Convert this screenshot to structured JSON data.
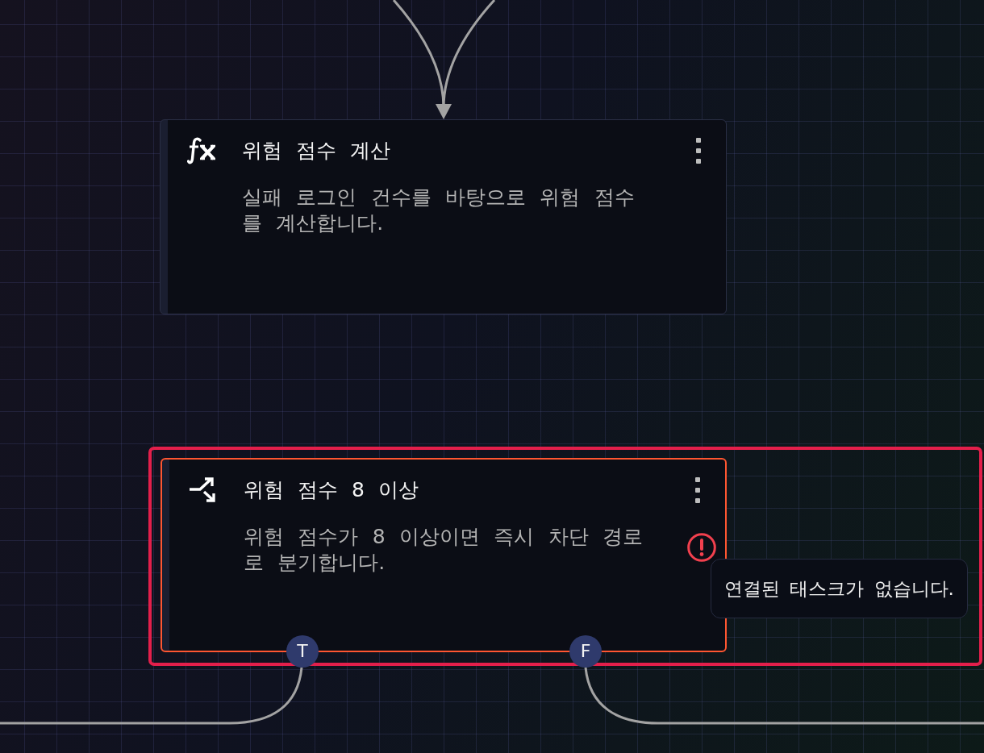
{
  "canvas": {
    "nodes": [
      {
        "kind": "function",
        "title": "위험 점수 계산",
        "description": "실패 로그인 건수를 바탕으로 위험 점수를 계산합니다.",
        "selected": false,
        "invalid": false
      },
      {
        "kind": "condition",
        "title": "위험 점수 8 이상",
        "description": "위험 점수가 8 이상이면 즉시 차단 경로로 분기합니다.",
        "selected": true,
        "invalid": true,
        "tooltip": "연결된 태스크가 없습니다.",
        "outputs": [
          {
            "label": "T"
          },
          {
            "label": "F"
          }
        ]
      }
    ]
  }
}
